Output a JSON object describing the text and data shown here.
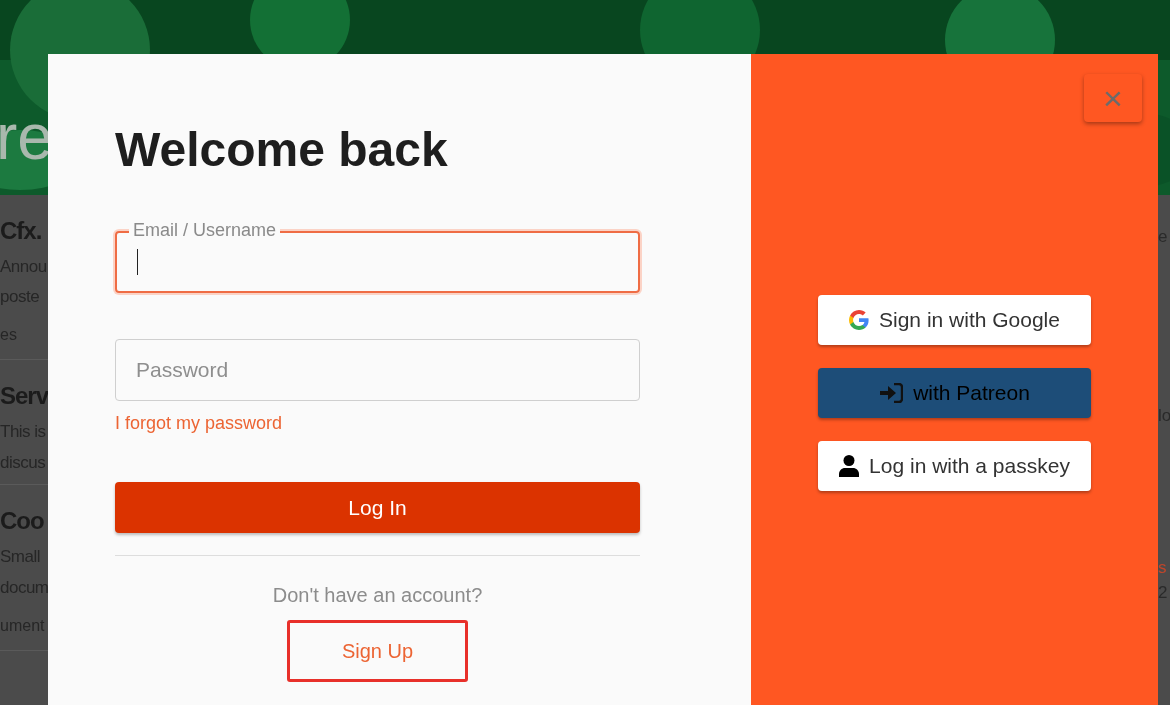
{
  "background_page": {
    "header_text": "re",
    "left_items": [
      {
        "title": "Cfx.",
        "lines": [
          "Annou",
          "poste"
        ],
        "meta": "es"
      },
      {
        "title": "Serv",
        "lines": [
          "This is",
          "discus"
        ]
      },
      {
        "title": "Coo",
        "lines": [
          "Small",
          "docum"
        ],
        "meta": "ument"
      }
    ],
    "right_fragments": [
      {
        "text": "e",
        "kind": "text"
      },
      {
        "text": "lo",
        "kind": "text"
      },
      {
        "text": "s",
        "kind": "link"
      },
      {
        "text": "2",
        "kind": "text"
      }
    ]
  },
  "modal": {
    "title": "Welcome back",
    "fields": [
      {
        "kind": "floating",
        "label": "Email / Username",
        "focused": true
      },
      {
        "kind": "plain",
        "placeholder": "Password",
        "focused": false
      }
    ],
    "forgot_link": "I forgot my password",
    "login_button": "Log In",
    "signup_prompt": "Don't have an account?",
    "signup_link": {
      "label": "Sign Up",
      "highlighted": true
    },
    "close_button": "×",
    "providers": [
      {
        "kind": "google",
        "label": "Sign in with Google"
      },
      {
        "kind": "patreon",
        "label": "with Patreon"
      },
      {
        "kind": "passkey",
        "label": "Log in with a passkey"
      }
    ]
  }
}
